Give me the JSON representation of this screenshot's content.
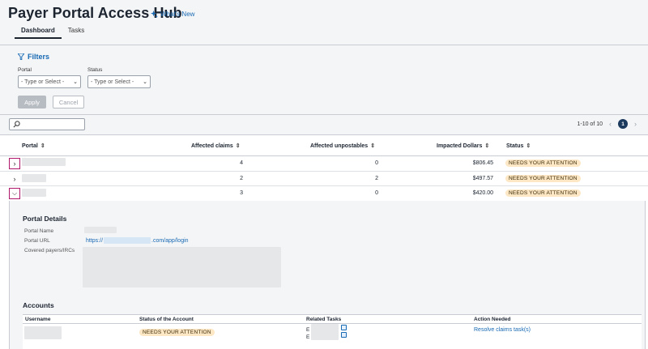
{
  "header": {
    "title": "Payer Portal Access Hub",
    "whats_new": "What's New",
    "tabs": [
      {
        "label": "Dashboard",
        "active": true
      },
      {
        "label": "Tasks",
        "active": false
      }
    ]
  },
  "filters": {
    "title": "Filters",
    "portal_label": "Portal",
    "portal_placeholder": "- Type or Select -",
    "status_label": "Status",
    "status_placeholder": "- Type or Select -",
    "apply_label": "Apply",
    "cancel_label": "Cancel"
  },
  "pagination": {
    "range": "1-10 of 10",
    "current_page": "1"
  },
  "table": {
    "columns": [
      "Portal",
      "Affected claims",
      "Affected unpostables",
      "Impacted Dollars",
      "Status"
    ],
    "rows": [
      {
        "affected_claims": "4",
        "affected_unpostables": "0",
        "impacted_dollars": "$806.45",
        "status": "NEEDS YOUR ATTENTION",
        "expanded": false
      },
      {
        "affected_claims": "2",
        "affected_unpostables": "2",
        "impacted_dollars": "$497.57",
        "status": "NEEDS YOUR ATTENTION",
        "expanded": false
      },
      {
        "affected_claims": "3",
        "affected_unpostables": "0",
        "impacted_dollars": "$420.00",
        "status": "NEEDS YOUR ATTENTION",
        "expanded": true
      }
    ]
  },
  "portal_details": {
    "title": "Portal Details",
    "portal_name_label": "Portal Name",
    "portal_url_label": "Portal URL",
    "portal_url_prefix": "https://",
    "portal_url_suffix": ".com/app/login",
    "covered_payers_label": "Covered payers/IRCs"
  },
  "accounts": {
    "title": "Accounts",
    "columns": [
      "Username",
      "Status of the Account",
      "Related Tasks",
      "Action Needed"
    ],
    "rows": [
      {
        "status": "NEEDS YOUR ATTENTION",
        "task_prefix_1": "E",
        "task_prefix_2": "E",
        "action": "Resolve claims task(s)"
      }
    ]
  },
  "colors": {
    "accent": "#1769b3",
    "status_badge_bg": "#fde7c4",
    "highlight": "#b0186b",
    "pager_active": "#1c3a5e"
  }
}
